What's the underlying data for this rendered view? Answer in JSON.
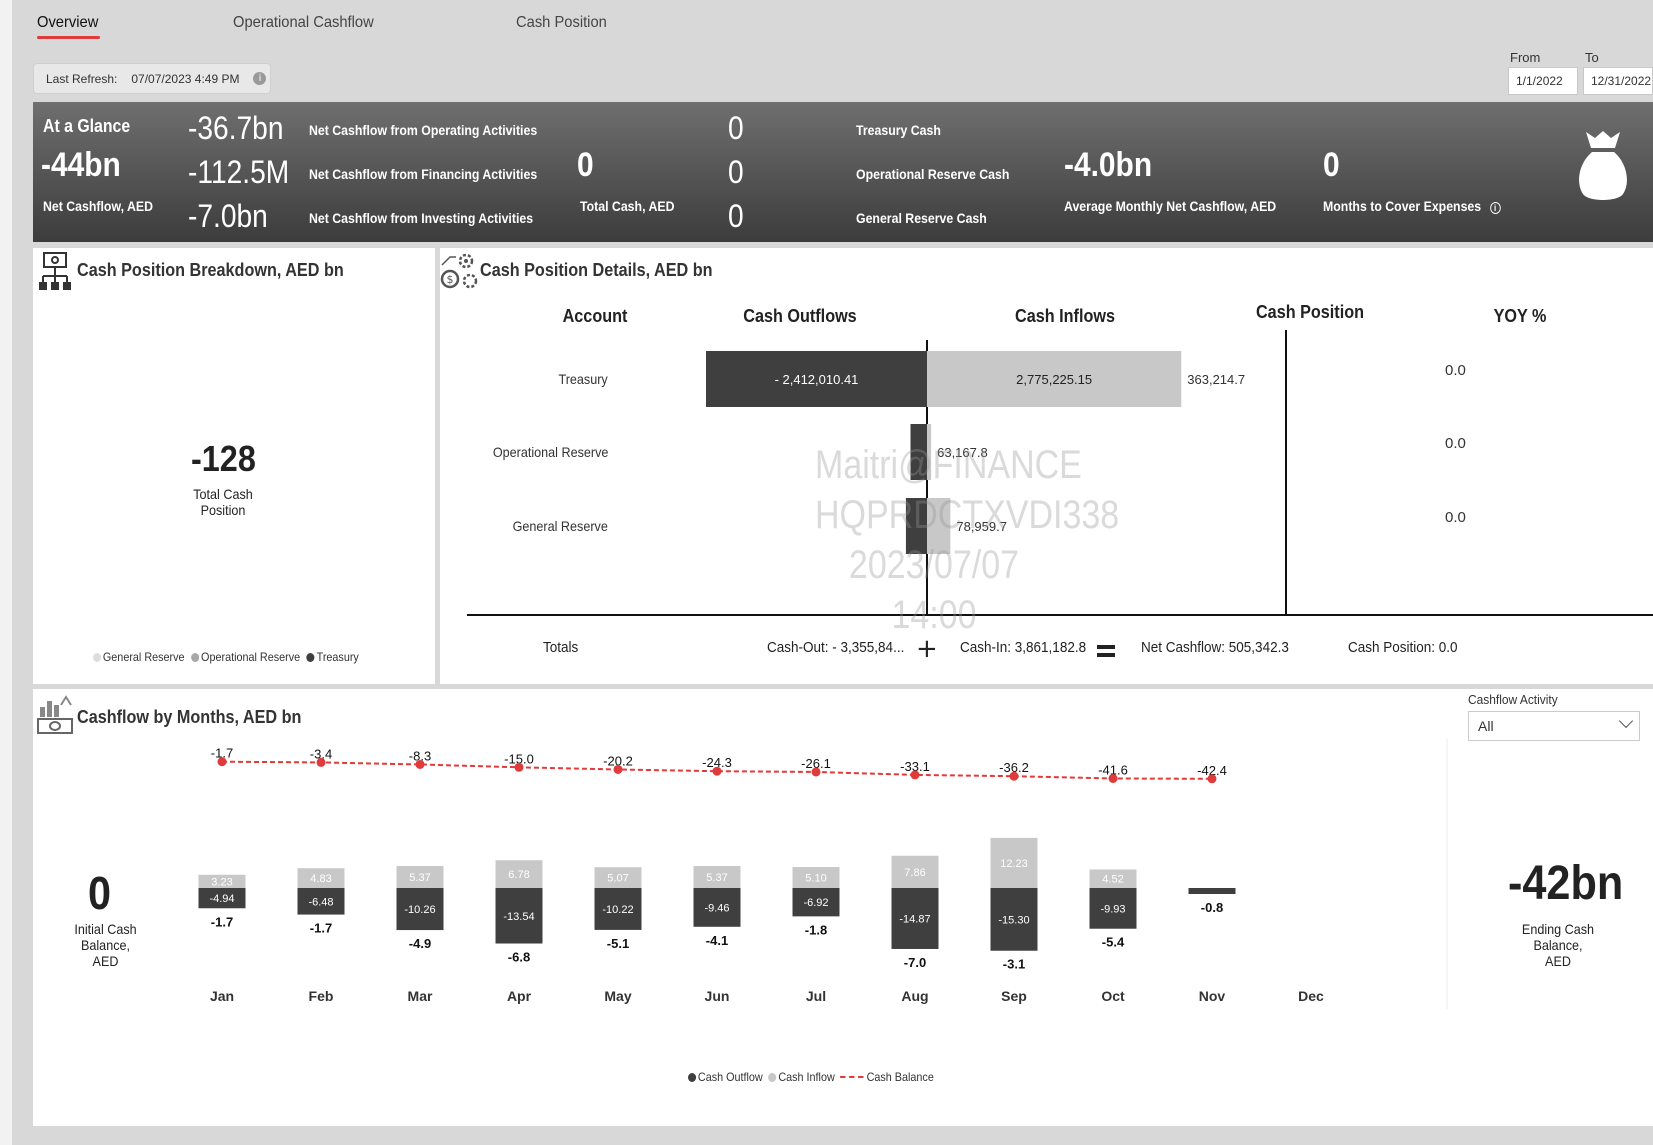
{
  "tabs": [
    {
      "label": "Overview",
      "active": true
    },
    {
      "label": "Operational Cashflow",
      "active": false
    },
    {
      "label": "Cash Position",
      "active": false
    }
  ],
  "refresh": {
    "label": "Last Refresh:",
    "value": "07/07/2023 4:49 PM",
    "info_icon": "i"
  },
  "date_range": {
    "from_label": "From",
    "to_label": "To",
    "from": "1/1/2022",
    "to": "12/31/2022"
  },
  "kpi": {
    "at_a_glance": "At a Glance",
    "net_cashflow": "-44bn",
    "net_cashflow_label": "Net Cashflow, AED",
    "operating_value": "-36.7bn",
    "operating_label": "Net Cashflow from Operating Activities",
    "financing_value": "-112.5M",
    "financing_label": "Net Cashflow from Financing Activities",
    "investing_value": "-7.0bn",
    "investing_label": "Net Cashflow from Investing Activities",
    "total_cash": "0",
    "total_cash_label": "Total Cash, AED",
    "treasury_value": "0",
    "treasury_label": "Treasury Cash",
    "opreserve_value": "0",
    "opreserve_label": "Operational Reserve Cash",
    "genreserve_value": "0",
    "genreserve_label": "General Reserve Cash",
    "avg_monthly": "-4.0bn",
    "avg_monthly_label": "Average Monthly Net Cashflow, AED",
    "months_cover": "0",
    "months_cover_label": "Months to Cover Expenses",
    "months_cover_info": "i"
  },
  "breakdown": {
    "title": "Cash Position Breakdown, AED bn",
    "total": "-128",
    "total_label_1": "Total Cash",
    "total_label_2": "Position",
    "legend": [
      {
        "label": "General Reserve",
        "color": "#dddddd"
      },
      {
        "label": "Operational Reserve",
        "color": "#a8a8a8"
      },
      {
        "label": "Treasury",
        "color": "#3f3f3f"
      }
    ]
  },
  "details": {
    "title": "Cash Position Details, AED bn",
    "headers": {
      "account": "Account",
      "outflows": "Cash Outflows",
      "inflows": "Cash Inflows",
      "position": "Cash Position",
      "yoy": "YOY %"
    },
    "rows": [
      {
        "account": "Treasury",
        "outflow": -2412010.41,
        "outflow_label": "- 2,412,010.41",
        "inflow": 2775225.15,
        "inflow_label": "2,775,225.15",
        "net_label": "363,214.7",
        "position": "0.0"
      },
      {
        "account": "Operational Reserve",
        "outflow": -180000,
        "outflow_label": "",
        "inflow": 45000,
        "inflow_label": "",
        "net_label": "63,167.8",
        "position": "0.0"
      },
      {
        "account": "General Reserve",
        "outflow": -230000,
        "outflow_label": "",
        "inflow": 255000,
        "inflow_label": "",
        "net_label": "78,959.7",
        "position": "0.0"
      }
    ],
    "totals": {
      "label": "Totals",
      "cash_out": "Cash-Out: - 3,355,84...",
      "cash_in": "Cash-In: 3,861,182.8",
      "net": "Net Cashflow: 505,342.3",
      "position_label": "Cash Position:",
      "position_value": "0.0"
    },
    "watermark": [
      "Maitri@FINANCE",
      "HQPRDCTXVDI338",
      "2023/07/07 14:00"
    ]
  },
  "monthly": {
    "title": "Cashflow by Months, AED bn",
    "filter_label": "Cashflow Activity",
    "filter_value": "All",
    "initial_value": "0",
    "initial_label_1": "Initial Cash Balance,",
    "initial_label_2": "AED",
    "ending_value": "-42bn",
    "ending_label_1": "Ending Cash Balance,",
    "ending_label_2": "AED",
    "legend": [
      {
        "label": "Cash Outflow",
        "color": "#3f3f3f"
      },
      {
        "label": "Cash Inflow",
        "color": "#c8c8c8"
      },
      {
        "label": "Cash Balance",
        "color": "#e03b3b"
      }
    ]
  },
  "chart_data": {
    "type": "bar",
    "categories": [
      "Jan",
      "Feb",
      "Mar",
      "Apr",
      "May",
      "Jun",
      "Jul",
      "Aug",
      "Sep",
      "Oct",
      "Nov",
      "Dec"
    ],
    "series": [
      {
        "name": "Cash Outflow",
        "values": [
          -4.94,
          -6.48,
          -10.26,
          -13.54,
          -10.22,
          -9.46,
          -6.92,
          -14.87,
          -15.3,
          -9.93,
          -0.8,
          null
        ]
      },
      {
        "name": "Cash Inflow",
        "values": [
          3.23,
          4.83,
          5.37,
          6.78,
          5.07,
          5.37,
          5.1,
          7.86,
          12.23,
          4.52,
          0,
          null
        ]
      },
      {
        "name": "Cash Balance",
        "values": [
          -1.7,
          -3.4,
          -8.3,
          -15.0,
          -20.2,
          -24.3,
          -26.1,
          -33.1,
          -36.2,
          -41.6,
          -42.4,
          null
        ]
      }
    ],
    "net_values": [
      -1.7,
      -1.7,
      -4.9,
      -6.8,
      -5.1,
      -4.1,
      -1.8,
      -7.0,
      -3.1,
      -5.4,
      -0.8,
      null
    ],
    "outflow_labels": [
      "-4.94",
      "-6.48",
      "-10.26",
      "-13.54",
      "-10.22",
      "-9.46",
      "-6.92",
      "-14.87",
      "-15.30",
      "-9.93",
      "",
      ""
    ],
    "inflow_labels": [
      "3.23",
      "4.83",
      "5.37",
      "6.78",
      "5.07",
      "5.37",
      "5.10",
      "7.86",
      "12.23",
      "4.52",
      "",
      ""
    ],
    "net_labels": [
      "-1.7",
      "-1.7",
      "-4.9",
      "-6.8",
      "-5.1",
      "-4.1",
      "-1.8",
      "-7.0",
      "-3.1",
      "-5.4",
      "-0.8",
      ""
    ],
    "balance_labels": [
      "-1.7",
      "-3.4",
      "-8.3",
      "-15.0",
      "-20.2",
      "-24.3",
      "-26.1",
      "-33.1",
      "-36.2",
      "-41.6",
      "-42.4",
      ""
    ],
    "title": "Cashflow by Months, AED bn",
    "xlabel": "",
    "ylabel": ""
  }
}
